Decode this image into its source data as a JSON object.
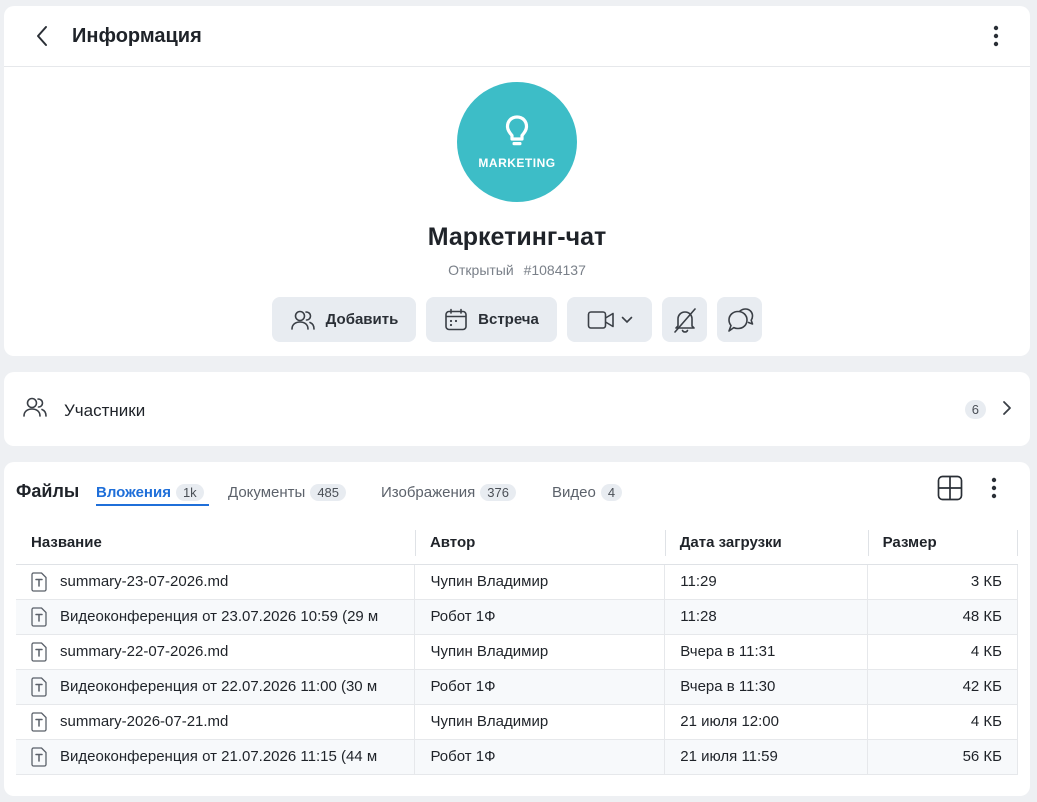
{
  "header": {
    "title": "Информация"
  },
  "chat": {
    "avatar_text": "MARKETING",
    "avatar_color": "#3dbdc7",
    "title": "Маркетинг-чат",
    "type": "Открытый",
    "id": "#1084137"
  },
  "actions": {
    "add_label": "Добавить",
    "meet_label": "Встреча"
  },
  "members": {
    "label": "Участники",
    "count": "6"
  },
  "files": {
    "title": "Файлы",
    "tabs": [
      {
        "label": "Вложения",
        "count": "1k"
      },
      {
        "label": "Документы",
        "count": "485"
      },
      {
        "label": "Изображения",
        "count": "376"
      },
      {
        "label": "Видео",
        "count": "4"
      }
    ],
    "columns": [
      "Название",
      "Автор",
      "Дата загрузки",
      "Размер"
    ],
    "rows": [
      {
        "name": "summary-23-07-2026.md",
        "author": "Чупин Владимир",
        "date": "11:29",
        "size": "3 КБ"
      },
      {
        "name": "Видеоконференция от 23.07.2026 10:59 (29 м",
        "author": "Робот 1Ф",
        "date": "11:28",
        "size": "48 КБ"
      },
      {
        "name": "summary-22-07-2026.md",
        "author": "Чупин Владимир",
        "date": "Вчера в 11:31",
        "size": "4 КБ"
      },
      {
        "name": "Видеоконференция от 22.07.2026 11:00 (30 м",
        "author": "Робот 1Ф",
        "date": "Вчера в 11:30",
        "size": "42 КБ"
      },
      {
        "name": "summary-2026-07-21.md",
        "author": "Чупин Владимир",
        "date": "21 июля 12:00",
        "size": "4 КБ"
      },
      {
        "name": "Видеоконференция от 21.07.2026 11:15 (44 м",
        "author": "Робот 1Ф",
        "date": "21 июля 11:59",
        "size": "56 КБ"
      }
    ]
  },
  "colors": {
    "accent": "#1f6fd9",
    "button_bg": "#e8ecf1"
  }
}
